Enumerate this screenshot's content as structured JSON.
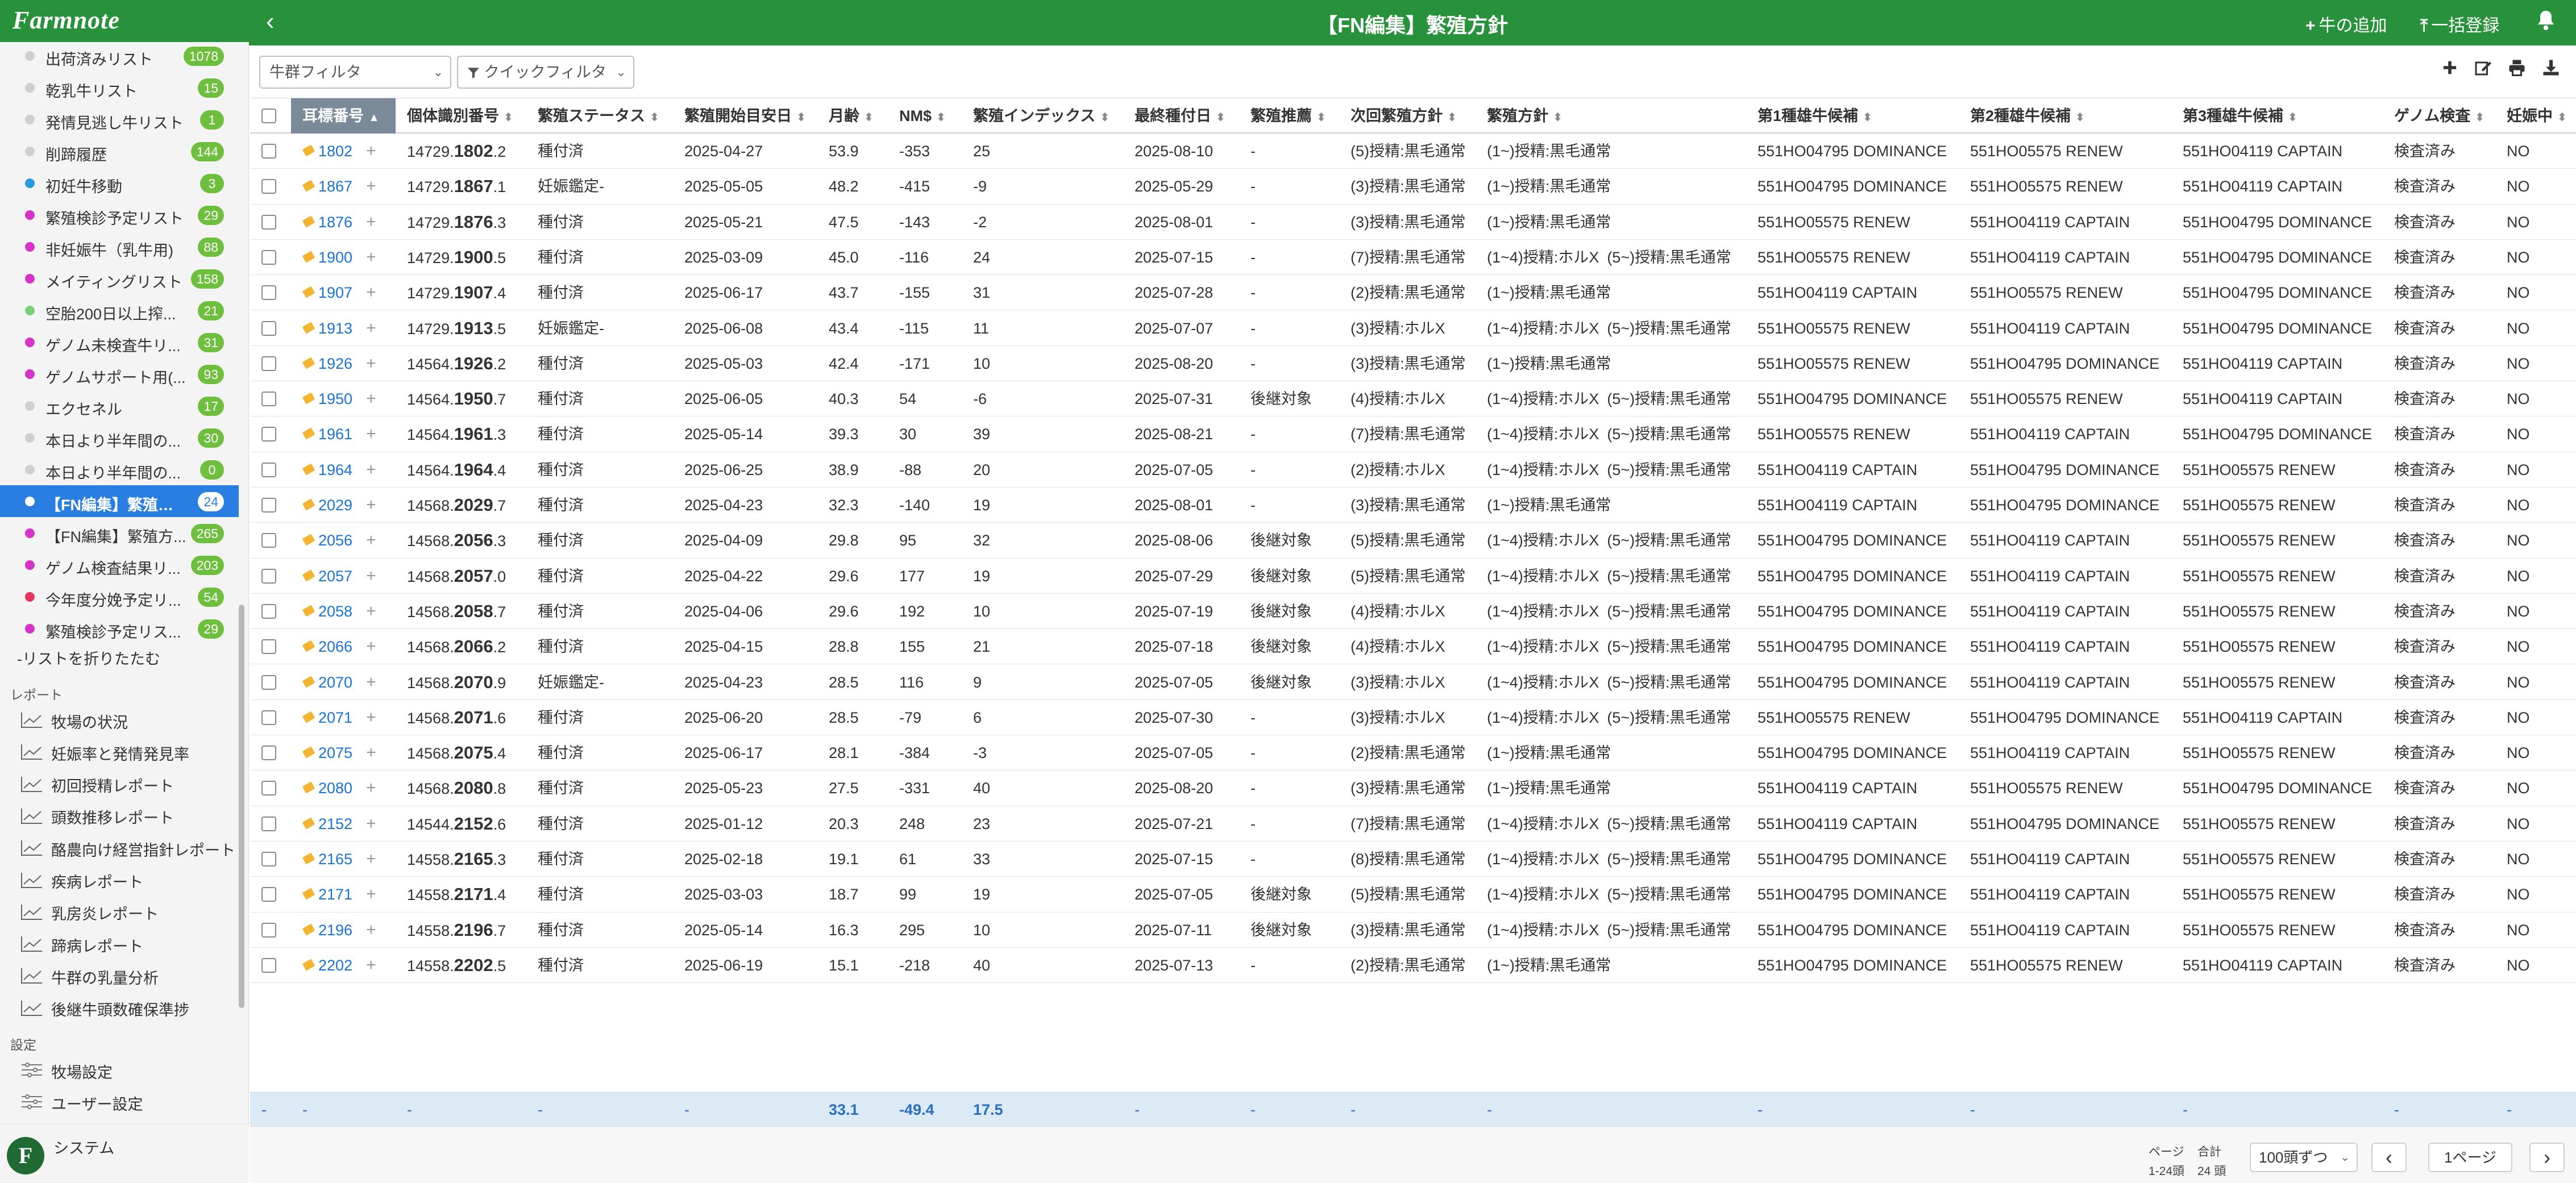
{
  "app": {
    "logo": "Farmnote",
    "title": "【FN編集】繁殖方針"
  },
  "header": {
    "back_icon": "‹",
    "add_cow_label": "牛の追加",
    "bulk_register_label": "一括登録",
    "add_cow_icon": "+",
    "bulk_register_icon": "⤒",
    "bell_icon": "bell-icon"
  },
  "sidebar": {
    "lists": [
      {
        "label": "出荷済みリスト",
        "badge": "1078",
        "color": "#cfcfcf"
      },
      {
        "label": "乾乳牛リスト",
        "badge": "15",
        "color": "#cfcfcf"
      },
      {
        "label": "発情見逃し牛リスト",
        "badge": "1",
        "color": "#cfcfcf"
      },
      {
        "label": "削蹄履歴",
        "badge": "144",
        "color": "#cfcfcf"
      },
      {
        "label": "初妊牛移動",
        "badge": "3",
        "color": "#2a9be0"
      },
      {
        "label": "繁殖検診予定リスト",
        "badge": "29",
        "color": "#d633c9"
      },
      {
        "label": "非妊娠牛（乳牛用)",
        "badge": "88",
        "color": "#d633c9"
      },
      {
        "label": "メイティングリスト",
        "badge": "158",
        "color": "#d633c9"
      },
      {
        "label": "空胎200日以上搾...",
        "badge": "21",
        "color": "#7ccf7a"
      },
      {
        "label": "ゲノム未検査牛リ...",
        "badge": "31",
        "color": "#d633c9"
      },
      {
        "label": "ゲノムサポート用(...",
        "badge": "93",
        "color": "#d633c9"
      },
      {
        "label": "エクセネル",
        "badge": "17",
        "color": "#cfcfcf"
      },
      {
        "label": "本日より半年間の...",
        "badge": "30",
        "color": "#cfcfcf"
      },
      {
        "label": "本日より半年間の...",
        "badge": "0",
        "color": "#cfcfcf"
      },
      {
        "label": "【FN編集】繁殖方針",
        "badge": "24",
        "color": "#ffffff",
        "active": true
      },
      {
        "label": "【FN編集】繁殖方...",
        "badge": "265",
        "color": "#d633c9"
      },
      {
        "label": "ゲノム検査結果リ...",
        "badge": "203",
        "color": "#d633c9"
      },
      {
        "label": "今年度分娩予定リ...",
        "badge": "54",
        "color": "#e2365c"
      },
      {
        "label": "繁殖検診予定リス...",
        "badge": "29",
        "color": "#d633c9"
      }
    ],
    "collapse_label": "-リストを折りたたむ",
    "reports_heading": "レポート",
    "reports": [
      "牧場の状況",
      "妊娠率と発情発見率",
      "初回授精レポート",
      "頭数推移レポート",
      "酪農向け経営指針レポート",
      "疾病レポート",
      "乳房炎レポート",
      "蹄病レポート",
      "牛群の乳量分析",
      "後継牛頭数確保準捗"
    ],
    "settings_heading": "設定",
    "settings": [
      "牧場設定",
      "ユーザー設定"
    ],
    "system_logo": "F",
    "system_label": "システム"
  },
  "toolbar": {
    "herd_filter": "牛群フィルタ",
    "quick_filter": "クイックフィルタ",
    "quick_filter_icon": "filter-icon",
    "icons": [
      "plus-icon",
      "edit-icon",
      "print-icon",
      "download-icon"
    ]
  },
  "table": {
    "columns": [
      "耳標番号",
      "個体識別番号",
      "繁殖ステータス",
      "繁殖開始目安日",
      "月齢",
      "NM$",
      "繁殖インデックス",
      "最終種付日",
      "繁殖推薦",
      "次回繁殖方針",
      "繁殖方針",
      "第1種雄牛候補",
      "第2種雄牛候補",
      "第3種雄牛候補",
      "ゲノム検査",
      "妊娠中"
    ],
    "rows": [
      {
        "ear": "1802",
        "id_pre": "14729.",
        "id_mid": "1802",
        "id_suf": ".2",
        "status": "種付済",
        "start": "2025-04-27",
        "age": "53.9",
        "nm": "-353",
        "idx": "25",
        "last": "2025-08-10",
        "rec": "-",
        "next": "(5)授精:黒毛通常",
        "policy_a": "(1~)授精:黒毛通常",
        "policy_b": "",
        "b1": "551HO04795 DOMINANCE",
        "b2": "551HO05575 RENEW",
        "b3": "551HO04119 CAPTAIN",
        "genome": "検査済み",
        "preg": "NO"
      },
      {
        "ear": "1867",
        "id_pre": "14729.",
        "id_mid": "1867",
        "id_suf": ".1",
        "status": "妊娠鑑定-",
        "start": "2025-05-05",
        "age": "48.2",
        "nm": "-415",
        "idx": "-9",
        "last": "2025-05-29",
        "rec": "-",
        "next": "(3)授精:黒毛通常",
        "policy_a": "(1~)授精:黒毛通常",
        "policy_b": "",
        "b1": "551HO04795 DOMINANCE",
        "b2": "551HO05575 RENEW",
        "b3": "551HO04119 CAPTAIN",
        "genome": "検査済み",
        "preg": "NO"
      },
      {
        "ear": "1876",
        "id_pre": "14729.",
        "id_mid": "1876",
        "id_suf": ".3",
        "status": "種付済",
        "start": "2025-05-21",
        "age": "47.5",
        "nm": "-143",
        "idx": "-2",
        "last": "2025-08-01",
        "rec": "-",
        "next": "(3)授精:黒毛通常",
        "policy_a": "(1~)授精:黒毛通常",
        "policy_b": "",
        "b1": "551HO05575 RENEW",
        "b2": "551HO04119 CAPTAIN",
        "b3": "551HO04795 DOMINANCE",
        "genome": "検査済み",
        "preg": "NO"
      },
      {
        "ear": "1900",
        "id_pre": "14729.",
        "id_mid": "1900",
        "id_suf": ".5",
        "status": "種付済",
        "start": "2025-03-09",
        "age": "45.0",
        "nm": "-116",
        "idx": "24",
        "last": "2025-07-15",
        "rec": "-",
        "next": "(7)授精:黒毛通常",
        "policy_a": "(1~4)授精:ホルX",
        "policy_b": "(5~)授精:黒毛通常",
        "b1": "551HO05575 RENEW",
        "b2": "551HO04119 CAPTAIN",
        "b3": "551HO04795 DOMINANCE",
        "genome": "検査済み",
        "preg": "NO"
      },
      {
        "ear": "1907",
        "id_pre": "14729.",
        "id_mid": "1907",
        "id_suf": ".4",
        "status": "種付済",
        "start": "2025-06-17",
        "age": "43.7",
        "nm": "-155",
        "idx": "31",
        "last": "2025-07-28",
        "rec": "-",
        "next": "(2)授精:黒毛通常",
        "policy_a": "(1~)授精:黒毛通常",
        "policy_b": "",
        "b1": "551HO04119 CAPTAIN",
        "b2": "551HO05575 RENEW",
        "b3": "551HO04795 DOMINANCE",
        "genome": "検査済み",
        "preg": "NO"
      },
      {
        "ear": "1913",
        "id_pre": "14729.",
        "id_mid": "1913",
        "id_suf": ".5",
        "status": "妊娠鑑定-",
        "start": "2025-06-08",
        "age": "43.4",
        "nm": "-115",
        "idx": "11",
        "last": "2025-07-07",
        "rec": "-",
        "next": "(3)授精:ホルX",
        "policy_a": "(1~4)授精:ホルX",
        "policy_b": "(5~)授精:黒毛通常",
        "b1": "551HO05575 RENEW",
        "b2": "551HO04119 CAPTAIN",
        "b3": "551HO04795 DOMINANCE",
        "genome": "検査済み",
        "preg": "NO"
      },
      {
        "ear": "1926",
        "id_pre": "14564.",
        "id_mid": "1926",
        "id_suf": ".2",
        "status": "種付済",
        "start": "2025-05-03",
        "age": "42.4",
        "nm": "-171",
        "idx": "10",
        "last": "2025-08-20",
        "rec": "-",
        "next": "(3)授精:黒毛通常",
        "policy_a": "(1~)授精:黒毛通常",
        "policy_b": "",
        "b1": "551HO05575 RENEW",
        "b2": "551HO04795 DOMINANCE",
        "b3": "551HO04119 CAPTAIN",
        "genome": "検査済み",
        "preg": "NO"
      },
      {
        "ear": "1950",
        "id_pre": "14564.",
        "id_mid": "1950",
        "id_suf": ".7",
        "status": "種付済",
        "start": "2025-06-05",
        "age": "40.3",
        "nm": "54",
        "idx": "-6",
        "last": "2025-07-31",
        "rec": "後継対象",
        "next": "(4)授精:ホルX",
        "policy_a": "(1~4)授精:ホルX",
        "policy_b": "(5~)授精:黒毛通常",
        "b1": "551HO04795 DOMINANCE",
        "b2": "551HO05575 RENEW",
        "b3": "551HO04119 CAPTAIN",
        "genome": "検査済み",
        "preg": "NO"
      },
      {
        "ear": "1961",
        "id_pre": "14564.",
        "id_mid": "1961",
        "id_suf": ".3",
        "status": "種付済",
        "start": "2025-05-14",
        "age": "39.3",
        "nm": "30",
        "idx": "39",
        "last": "2025-08-21",
        "rec": "-",
        "next": "(7)授精:黒毛通常",
        "policy_a": "(1~4)授精:ホルX",
        "policy_b": "(5~)授精:黒毛通常",
        "b1": "551HO05575 RENEW",
        "b2": "551HO04119 CAPTAIN",
        "b3": "551HO04795 DOMINANCE",
        "genome": "検査済み",
        "preg": "NO"
      },
      {
        "ear": "1964",
        "id_pre": "14564.",
        "id_mid": "1964",
        "id_suf": ".4",
        "status": "種付済",
        "start": "2025-06-25",
        "age": "38.9",
        "nm": "-88",
        "idx": "20",
        "last": "2025-07-05",
        "rec": "-",
        "next": "(2)授精:ホルX",
        "policy_a": "(1~4)授精:ホルX",
        "policy_b": "(5~)授精:黒毛通常",
        "b1": "551HO04119 CAPTAIN",
        "b2": "551HO04795 DOMINANCE",
        "b3": "551HO05575 RENEW",
        "genome": "検査済み",
        "preg": "NO"
      },
      {
        "ear": "2029",
        "id_pre": "14568.",
        "id_mid": "2029",
        "id_suf": ".7",
        "status": "種付済",
        "start": "2025-04-23",
        "age": "32.3",
        "nm": "-140",
        "idx": "19",
        "last": "2025-08-01",
        "rec": "-",
        "next": "(3)授精:黒毛通常",
        "policy_a": "(1~)授精:黒毛通常",
        "policy_b": "",
        "b1": "551HO04119 CAPTAIN",
        "b2": "551HO04795 DOMINANCE",
        "b3": "551HO05575 RENEW",
        "genome": "検査済み",
        "preg": "NO"
      },
      {
        "ear": "2056",
        "id_pre": "14568.",
        "id_mid": "2056",
        "id_suf": ".3",
        "status": "種付済",
        "start": "2025-04-09",
        "age": "29.8",
        "nm": "95",
        "idx": "32",
        "last": "2025-08-06",
        "rec": "後継対象",
        "next": "(5)授精:黒毛通常",
        "policy_a": "(1~4)授精:ホルX",
        "policy_b": "(5~)授精:黒毛通常",
        "b1": "551HO04795 DOMINANCE",
        "b2": "551HO04119 CAPTAIN",
        "b3": "551HO05575 RENEW",
        "genome": "検査済み",
        "preg": "NO"
      },
      {
        "ear": "2057",
        "id_pre": "14568.",
        "id_mid": "2057",
        "id_suf": ".0",
        "status": "種付済",
        "start": "2025-04-22",
        "age": "29.6",
        "nm": "177",
        "idx": "19",
        "last": "2025-07-29",
        "rec": "後継対象",
        "next": "(5)授精:黒毛通常",
        "policy_a": "(1~4)授精:ホルX",
        "policy_b": "(5~)授精:黒毛通常",
        "b1": "551HO04795 DOMINANCE",
        "b2": "551HO04119 CAPTAIN",
        "b3": "551HO05575 RENEW",
        "genome": "検査済み",
        "preg": "NO"
      },
      {
        "ear": "2058",
        "id_pre": "14568.",
        "id_mid": "2058",
        "id_suf": ".7",
        "status": "種付済",
        "start": "2025-04-06",
        "age": "29.6",
        "nm": "192",
        "idx": "10",
        "last": "2025-07-19",
        "rec": "後継対象",
        "next": "(4)授精:ホルX",
        "policy_a": "(1~4)授精:ホルX",
        "policy_b": "(5~)授精:黒毛通常",
        "b1": "551HO04795 DOMINANCE",
        "b2": "551HO04119 CAPTAIN",
        "b3": "551HO05575 RENEW",
        "genome": "検査済み",
        "preg": "NO"
      },
      {
        "ear": "2066",
        "id_pre": "14568.",
        "id_mid": "2066",
        "id_suf": ".2",
        "status": "種付済",
        "start": "2025-04-15",
        "age": "28.8",
        "nm": "155",
        "idx": "21",
        "last": "2025-07-18",
        "rec": "後継対象",
        "next": "(4)授精:ホルX",
        "policy_a": "(1~4)授精:ホルX",
        "policy_b": "(5~)授精:黒毛通常",
        "b1": "551HO04795 DOMINANCE",
        "b2": "551HO04119 CAPTAIN",
        "b3": "551HO05575 RENEW",
        "genome": "検査済み",
        "preg": "NO"
      },
      {
        "ear": "2070",
        "id_pre": "14568.",
        "id_mid": "2070",
        "id_suf": ".9",
        "status": "妊娠鑑定-",
        "start": "2025-04-23",
        "age": "28.5",
        "nm": "116",
        "idx": "9",
        "last": "2025-07-05",
        "rec": "後継対象",
        "next": "(3)授精:ホルX",
        "policy_a": "(1~4)授精:ホルX",
        "policy_b": "(5~)授精:黒毛通常",
        "b1": "551HO04795 DOMINANCE",
        "b2": "551HO04119 CAPTAIN",
        "b3": "551HO05575 RENEW",
        "genome": "検査済み",
        "preg": "NO"
      },
      {
        "ear": "2071",
        "id_pre": "14568.",
        "id_mid": "2071",
        "id_suf": ".6",
        "status": "種付済",
        "start": "2025-06-20",
        "age": "28.5",
        "nm": "-79",
        "idx": "6",
        "last": "2025-07-30",
        "rec": "-",
        "next": "(3)授精:ホルX",
        "policy_a": "(1~4)授精:ホルX",
        "policy_b": "(5~)授精:黒毛通常",
        "b1": "551HO05575 RENEW",
        "b2": "551HO04795 DOMINANCE",
        "b3": "551HO04119 CAPTAIN",
        "genome": "検査済み",
        "preg": "NO"
      },
      {
        "ear": "2075",
        "id_pre": "14568.",
        "id_mid": "2075",
        "id_suf": ".4",
        "status": "種付済",
        "start": "2025-06-17",
        "age": "28.1",
        "nm": "-384",
        "idx": "-3",
        "last": "2025-07-05",
        "rec": "-",
        "next": "(2)授精:黒毛通常",
        "policy_a": "(1~)授精:黒毛通常",
        "policy_b": "",
        "b1": "551HO04795 DOMINANCE",
        "b2": "551HO04119 CAPTAIN",
        "b3": "551HO05575 RENEW",
        "genome": "検査済み",
        "preg": "NO"
      },
      {
        "ear": "2080",
        "id_pre": "14568.",
        "id_mid": "2080",
        "id_suf": ".8",
        "status": "種付済",
        "start": "2025-05-23",
        "age": "27.5",
        "nm": "-331",
        "idx": "40",
        "last": "2025-08-20",
        "rec": "-",
        "next": "(3)授精:黒毛通常",
        "policy_a": "(1~)授精:黒毛通常",
        "policy_b": "",
        "b1": "551HO04119 CAPTAIN",
        "b2": "551HO05575 RENEW",
        "b3": "551HO04795 DOMINANCE",
        "genome": "検査済み",
        "preg": "NO"
      },
      {
        "ear": "2152",
        "id_pre": "14544.",
        "id_mid": "2152",
        "id_suf": ".6",
        "status": "種付済",
        "start": "2025-01-12",
        "age": "20.3",
        "nm": "248",
        "idx": "23",
        "last": "2025-07-21",
        "rec": "-",
        "next": "(7)授精:黒毛通常",
        "policy_a": "(1~4)授精:ホルX",
        "policy_b": "(5~)授精:黒毛通常",
        "b1": "551HO04119 CAPTAIN",
        "b2": "551HO04795 DOMINANCE",
        "b3": "551HO05575 RENEW",
        "genome": "検査済み",
        "preg": "NO"
      },
      {
        "ear": "2165",
        "id_pre": "14558.",
        "id_mid": "2165",
        "id_suf": ".3",
        "status": "種付済",
        "start": "2025-02-18",
        "age": "19.1",
        "nm": "61",
        "idx": "33",
        "last": "2025-07-15",
        "rec": "-",
        "next": "(8)授精:黒毛通常",
        "policy_a": "(1~4)授精:ホルX",
        "policy_b": "(5~)授精:黒毛通常",
        "b1": "551HO04795 DOMINANCE",
        "b2": "551HO04119 CAPTAIN",
        "b3": "551HO05575 RENEW",
        "genome": "検査済み",
        "preg": "NO"
      },
      {
        "ear": "2171",
        "id_pre": "14558.",
        "id_mid": "2171",
        "id_suf": ".4",
        "status": "種付済",
        "start": "2025-03-03",
        "age": "18.7",
        "nm": "99",
        "idx": "19",
        "last": "2025-07-05",
        "rec": "後継対象",
        "next": "(5)授精:黒毛通常",
        "policy_a": "(1~4)授精:ホルX",
        "policy_b": "(5~)授精:黒毛通常",
        "b1": "551HO04795 DOMINANCE",
        "b2": "551HO04119 CAPTAIN",
        "b3": "551HO05575 RENEW",
        "genome": "検査済み",
        "preg": "NO"
      },
      {
        "ear": "2196",
        "id_pre": "14558.",
        "id_mid": "2196",
        "id_suf": ".7",
        "status": "種付済",
        "start": "2025-05-14",
        "age": "16.3",
        "nm": "295",
        "idx": "10",
        "last": "2025-07-11",
        "rec": "後継対象",
        "next": "(3)授精:黒毛通常",
        "policy_a": "(1~4)授精:ホルX",
        "policy_b": "(5~)授精:黒毛通常",
        "b1": "551HO04795 DOMINANCE",
        "b2": "551HO04119 CAPTAIN",
        "b3": "551HO05575 RENEW",
        "genome": "検査済み",
        "preg": "NO"
      },
      {
        "ear": "2202",
        "id_pre": "14558.",
        "id_mid": "2202",
        "id_suf": ".5",
        "status": "種付済",
        "start": "2025-06-19",
        "age": "15.1",
        "nm": "-218",
        "idx": "40",
        "last": "2025-07-13",
        "rec": "-",
        "next": "(2)授精:黒毛通常",
        "policy_a": "(1~)授精:黒毛通常",
        "policy_b": "",
        "b1": "551HO04795 DOMINANCE",
        "b2": "551HO05575 RENEW",
        "b3": "551HO04119 CAPTAIN",
        "genome": "検査済み",
        "preg": "NO"
      }
    ],
    "footer": [
      "-",
      "-",
      "-",
      "-",
      "-",
      "-",
      "33.1",
      "-49.4",
      "17.5",
      "-",
      "-",
      "-",
      "-",
      "-",
      "-",
      "-",
      "-",
      "-"
    ]
  },
  "pagination": {
    "page_label": "ページ",
    "total_label": "合計",
    "range_text": "1-24頭",
    "total_text": "24 頭",
    "per_page": "100頭ずつ",
    "current_page": "1ページ",
    "prev_icon": "‹",
    "next_icon": "›"
  }
}
